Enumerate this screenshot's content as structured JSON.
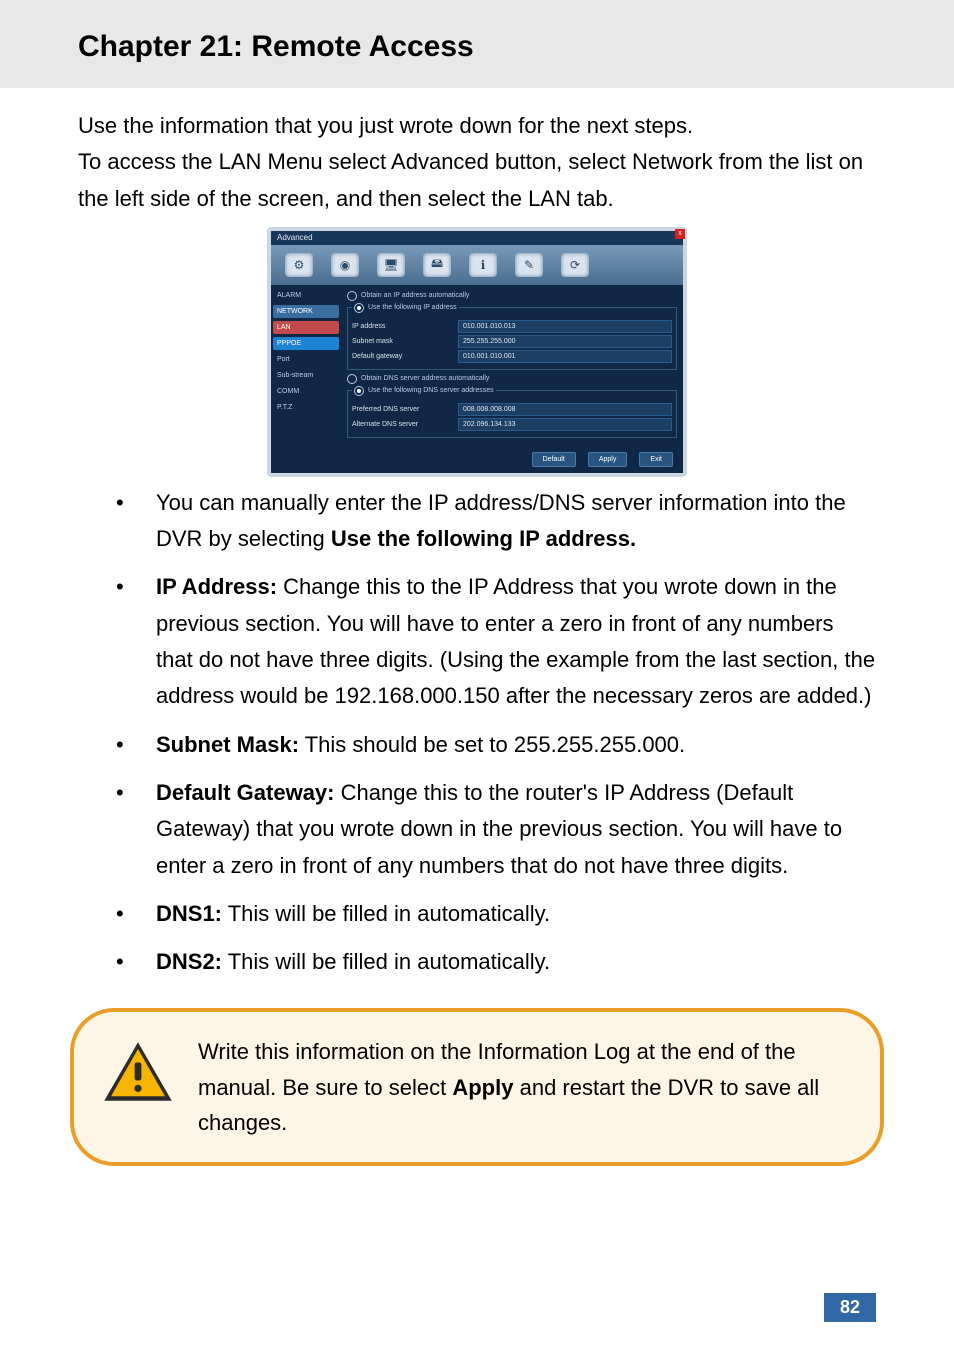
{
  "header": {
    "title": "Chapter 21: Remote Access"
  },
  "intro": {
    "p1": "Use the information that you just wrote down for the next steps.",
    "p2": "To access the LAN Menu select Advanced button, select Network from the list on the left side of the screen, and then select the LAN tab."
  },
  "dvr": {
    "window_title": "Advanced",
    "close": "x",
    "sidebar": [
      "ALARM",
      "NETWORK",
      "LAN",
      "PPPOE",
      "Port",
      "Sub-stream",
      "COMM",
      "P.T.Z"
    ],
    "radio_auto": "Obtain an IP address automatically",
    "radio_manual": "Use the following IP address",
    "ip_fields": [
      {
        "k": "IP address",
        "v": "010.001.010.013"
      },
      {
        "k": "Subnet mask",
        "v": "255.255.255.000"
      },
      {
        "k": "Default gateway",
        "v": "010.001.010.001"
      }
    ],
    "radio_dns_auto": "Obtain DNS server address automatically",
    "radio_dns_manual": "Use the following DNS server addresses",
    "dns_fields": [
      {
        "k": "Preferred DNS server",
        "v": "008.008.008.008"
      },
      {
        "k": "Alternate DNS server",
        "v": "202.096.134.133"
      }
    ],
    "buttons": {
      "default": "Default",
      "apply": "Apply",
      "exit": "Exit"
    }
  },
  "bullets": {
    "b1a": "You can manually enter the IP address/DNS server information into the DVR by selecting ",
    "b1b": "Use the following IP address.",
    "b2a": "IP Address:",
    "b2b": " Change this to the IP Address that you wrote down in the previous section. You will have to enter a zero in front of any numbers that do not have three digits. (Using the example from the last section, the address would be 192.168.000.150 after the necessary zeros are added.)",
    "b3a": "Subnet Mask:",
    "b3b": " This should be set to 255.255.255.000.",
    "b4a": "Default Gateway:",
    "b4b": " Change this to the router's IP Address (Default Gateway) that you wrote down in the previous section. You will have to enter a zero in front of any numbers that do not have three digits.",
    "b5a": "DNS1:",
    "b5b": " This will be filled in automatically.",
    "b6a": "DNS2:",
    "b6b": " This will be filled in automatically."
  },
  "callout": {
    "t1": "Write this information on the Information Log at the end of the manual. Be sure to select ",
    "tb": "Apply",
    "t2": " and restart the DVR to save all changes."
  },
  "page_number": "82"
}
